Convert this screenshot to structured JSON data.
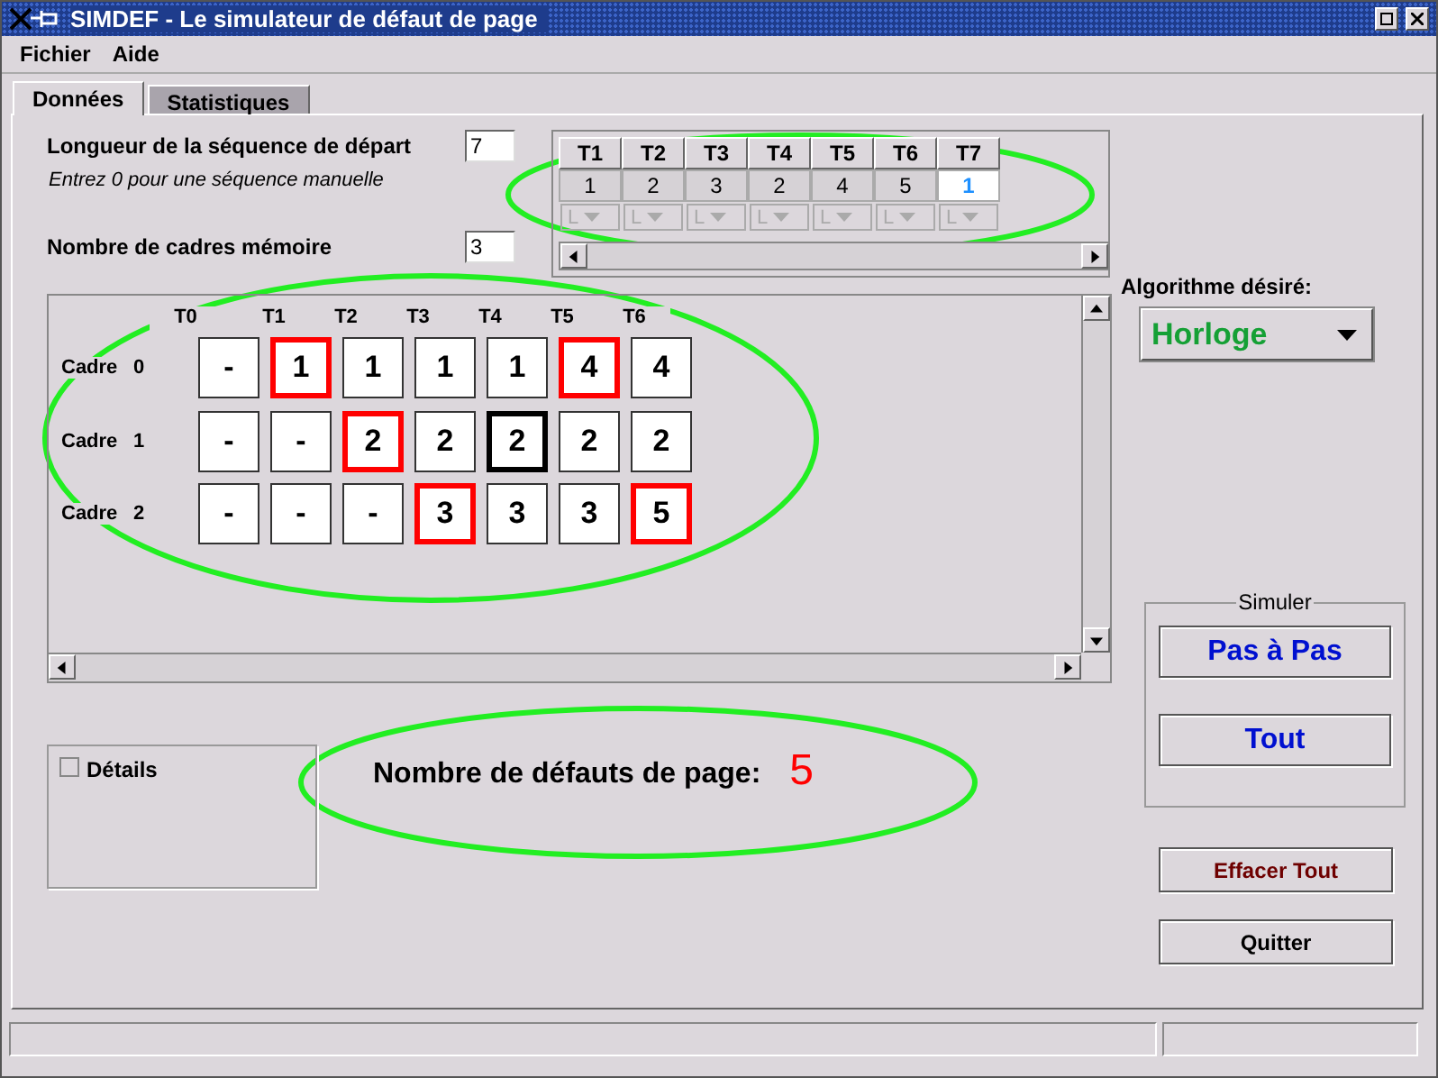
{
  "window": {
    "title": "SIMDEF - Le simulateur de défaut de page"
  },
  "menu": [
    {
      "label": "Fichier"
    },
    {
      "label": "Aide"
    }
  ],
  "tabs": [
    {
      "label": "Données",
      "selected": true
    },
    {
      "label": "Statistiques",
      "selected": false
    }
  ],
  "sequence_length": {
    "label": "Longueur de la séquence de départ",
    "value": "7",
    "hint": "Entrez 0 pour une séquence manuelle"
  },
  "frame_count": {
    "label": "Nombre de cadres mémoire",
    "value": "3"
  },
  "sequence_table": {
    "columns": [
      "T1",
      "T2",
      "T3",
      "T4",
      "T5",
      "T6",
      "T7"
    ],
    "pages": [
      {
        "value": "1",
        "selected": false
      },
      {
        "value": "2",
        "selected": false
      },
      {
        "value": "3",
        "selected": false
      },
      {
        "value": "2",
        "selected": false
      },
      {
        "value": "4",
        "selected": false
      },
      {
        "value": "5",
        "selected": false
      },
      {
        "value": "1",
        "selected": true
      }
    ],
    "modes": [
      {
        "value": "L",
        "disabled": true
      },
      {
        "value": "L",
        "disabled": true
      },
      {
        "value": "L",
        "disabled": true
      },
      {
        "value": "L",
        "disabled": true
      },
      {
        "value": "L",
        "disabled": true
      },
      {
        "value": "L",
        "disabled": true
      },
      {
        "value": "L",
        "disabled": true
      }
    ]
  },
  "frames_grid": {
    "columns": [
      "T0",
      "T1",
      "T2",
      "T3",
      "T4",
      "T5",
      "T6"
    ],
    "rows": [
      {
        "label": "Cadre",
        "index": "0",
        "cells": [
          {
            "value": "-",
            "fault": false,
            "current": false
          },
          {
            "value": "1",
            "fault": true,
            "current": false
          },
          {
            "value": "1",
            "fault": false,
            "current": false
          },
          {
            "value": "1",
            "fault": false,
            "current": false
          },
          {
            "value": "1",
            "fault": false,
            "current": false
          },
          {
            "value": "4",
            "fault": true,
            "current": false
          },
          {
            "value": "4",
            "fault": false,
            "current": false
          }
        ]
      },
      {
        "label": "Cadre",
        "index": "1",
        "cells": [
          {
            "value": "-",
            "fault": false,
            "current": false
          },
          {
            "value": "-",
            "fault": false,
            "current": false
          },
          {
            "value": "2",
            "fault": true,
            "current": false
          },
          {
            "value": "2",
            "fault": false,
            "current": false
          },
          {
            "value": "2",
            "fault": false,
            "current": true
          },
          {
            "value": "2",
            "fault": false,
            "current": false
          },
          {
            "value": "2",
            "fault": false,
            "current": false
          }
        ]
      },
      {
        "label": "Cadre",
        "index": "2",
        "cells": [
          {
            "value": "-",
            "fault": false,
            "current": false
          },
          {
            "value": "-",
            "fault": false,
            "current": false
          },
          {
            "value": "-",
            "fault": false,
            "current": false
          },
          {
            "value": "3",
            "fault": true,
            "current": false
          },
          {
            "value": "3",
            "fault": false,
            "current": false
          },
          {
            "value": "3",
            "fault": false,
            "current": false
          },
          {
            "value": "5",
            "fault": true,
            "current": false
          }
        ]
      }
    ]
  },
  "algorithm": {
    "label": "Algorithme désiré:",
    "value": "Horloge"
  },
  "details": {
    "label": "Détails",
    "checked": false
  },
  "fault_count": {
    "label": "Nombre de défauts de page:",
    "value": "5"
  },
  "simulate": {
    "title": "Simuler",
    "buttons": [
      {
        "label": "Pas à Pas"
      },
      {
        "label": "Tout"
      }
    ]
  },
  "buttons": [
    {
      "label": "Effacer Tout",
      "kind": "danger"
    },
    {
      "label": "Quitter",
      "kind": "plain"
    }
  ]
}
